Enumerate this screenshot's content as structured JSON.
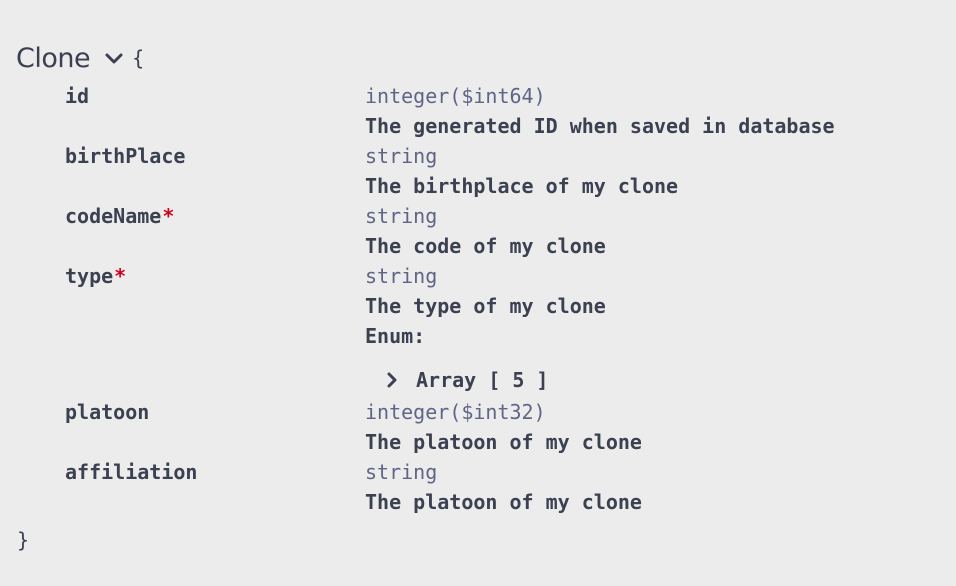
{
  "model": {
    "title": "Clone",
    "toggle_icon": "chevron-down-icon",
    "open_brace": "{",
    "close_brace": "}"
  },
  "properties": [
    {
      "name": "id",
      "required": false,
      "type": "integer($int64)",
      "description": "The generated ID when saved in database"
    },
    {
      "name": "birthPlace",
      "required": false,
      "type": "string",
      "description": "The birthplace of my clone"
    },
    {
      "name": "codeName",
      "required": true,
      "type": "string",
      "description": "The code of my clone"
    },
    {
      "name": "type",
      "required": true,
      "type": "string",
      "description": "The type of my clone",
      "enum_label": "Enum:",
      "enum_toggle": "Array [ 5 ]"
    },
    {
      "name": "platoon",
      "required": false,
      "type": "integer($int32)",
      "description": "The platoon of my clone"
    },
    {
      "name": "affiliation",
      "required": false,
      "type": "string",
      "description": "The platoon of my clone"
    }
  ],
  "required_marker": "*",
  "colors": {
    "background": "#ececed",
    "text": "#3b4151",
    "type": "#606586",
    "required": "#d0021b"
  }
}
